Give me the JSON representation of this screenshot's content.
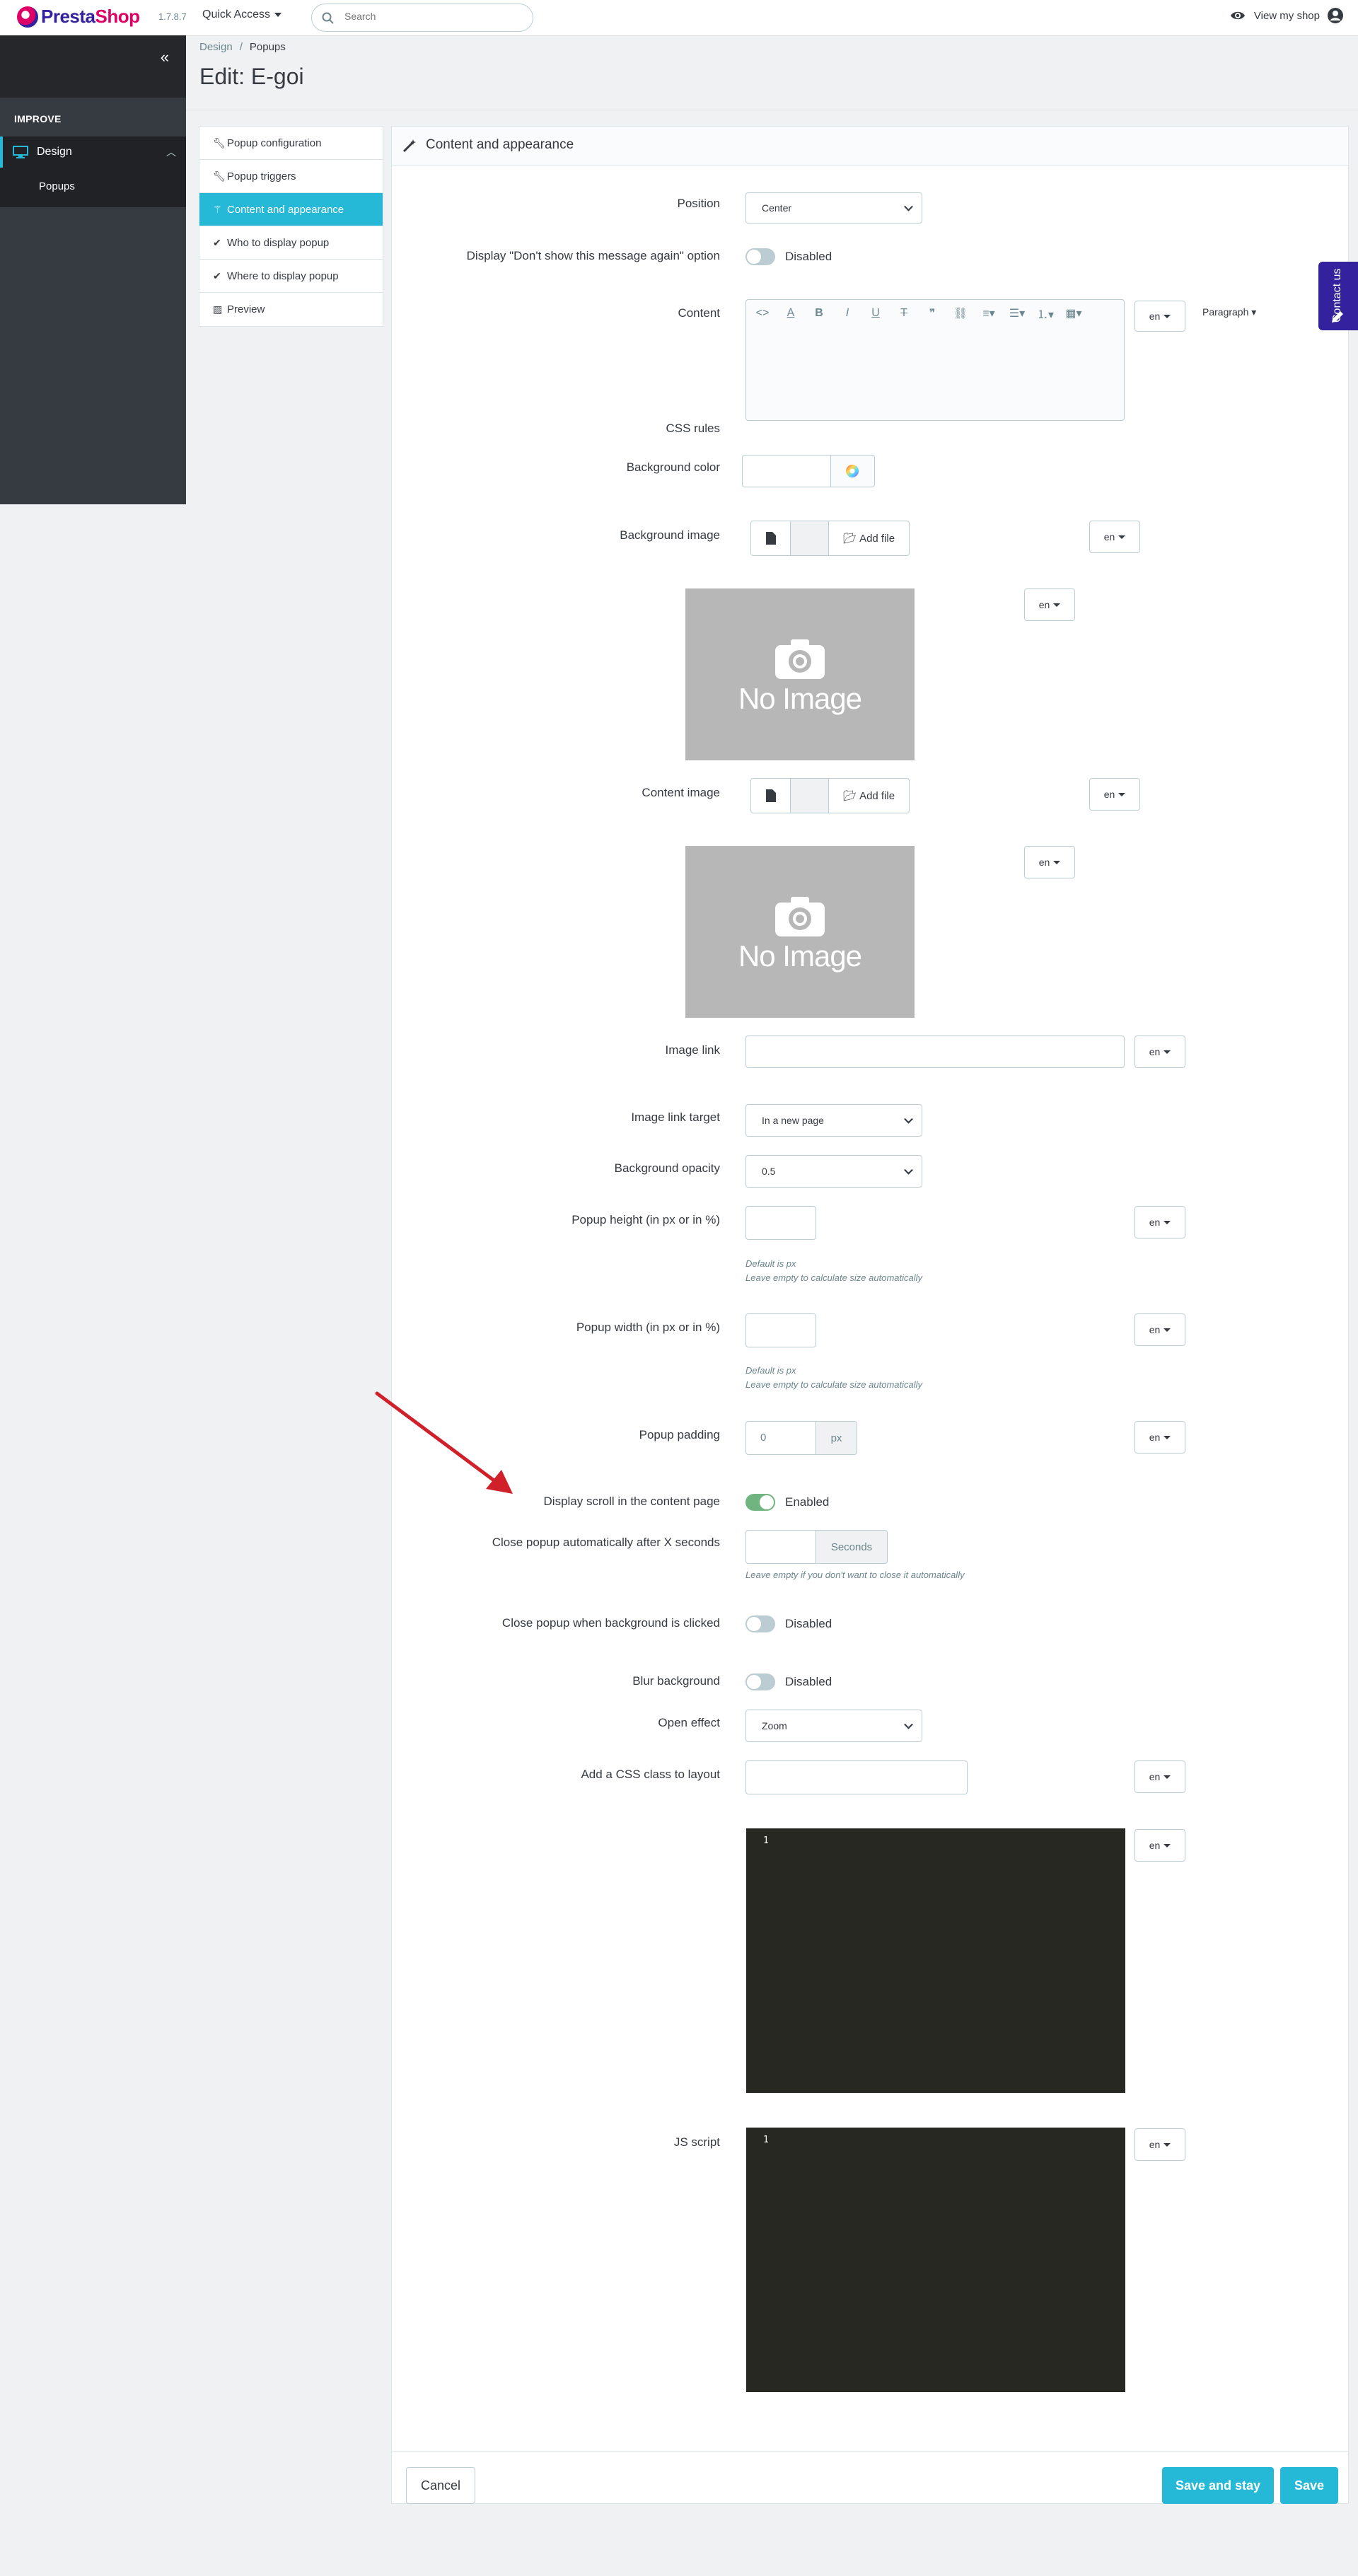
{
  "header": {
    "logo_text_a": "Presta",
    "logo_text_b": "Shop",
    "version": "1.7.8.7",
    "quick_access": "Quick Access",
    "search_placeholder": "Search",
    "view_shop": "View my shop"
  },
  "sidebar": {
    "section": "IMPROVE",
    "items": [
      {
        "label": "Design",
        "active": true
      },
      {
        "label": "Popups",
        "active": true
      }
    ]
  },
  "breadcrumb": {
    "parent": "Design",
    "current": "Popups"
  },
  "page_title": "Edit: E-goi",
  "tabs": [
    {
      "label": "Popup configuration",
      "icon": "wrench-icon"
    },
    {
      "label": "Popup triggers",
      "icon": "wrench-icon"
    },
    {
      "label": "Content and appearance",
      "icon": "magic-wand-icon",
      "active": true
    },
    {
      "label": "Who to display popup",
      "icon": "check-icon"
    },
    {
      "label": "Where to display popup",
      "icon": "check-icon"
    },
    {
      "label": "Preview",
      "icon": "image-icon"
    }
  ],
  "panel": {
    "title": "Content and appearance",
    "fields": {
      "position": {
        "label": "Position",
        "value": "Center"
      },
      "dont_show": {
        "label": "Display \"Don't show this message again\" option",
        "state": "Disabled"
      },
      "content": {
        "label": "Content",
        "paragraph": "Paragraph"
      },
      "bg_color": {
        "label": "Background color"
      },
      "bg_image": {
        "label": "Background image",
        "add_file": "Add file",
        "no_image": "No Image"
      },
      "content_image": {
        "label": "Content image",
        "add_file": "Add file",
        "no_image": "No Image"
      },
      "image_link": {
        "label": "Image link"
      },
      "image_link_target": {
        "label": "Image link target",
        "value": "In a new page"
      },
      "bg_opacity": {
        "label": "Background opacity",
        "value": "0.5"
      },
      "popup_height": {
        "label": "Popup height (in px or in %)",
        "help1": "Default is px",
        "help2": "Leave empty to calculate size automatically"
      },
      "popup_width": {
        "label": "Popup width (in px or in %)",
        "help1": "Default is px",
        "help2": "Leave empty to calculate size automatically"
      },
      "popup_padding": {
        "label": "Popup padding",
        "value": "0",
        "unit": "px"
      },
      "display_scroll": {
        "label": "Display scroll in the content page",
        "state": "Enabled"
      },
      "close_auto": {
        "label": "Close popup automatically after X seconds",
        "unit": "Seconds",
        "help": "Leave empty if you don't want to close it automatically"
      },
      "close_bg": {
        "label": "Close popup when background is clicked",
        "state": "Disabled"
      },
      "blur_bg": {
        "label": "Blur background",
        "state": "Disabled"
      },
      "open_effect": {
        "label": "Open effect",
        "value": "Zoom"
      },
      "css_class": {
        "label": "Add a CSS class to layout"
      },
      "css_rules": {
        "label": "CSS rules",
        "line": "1"
      },
      "js_script": {
        "label": "JS script",
        "line": "1"
      }
    },
    "lang": "en",
    "buttons": {
      "cancel": "Cancel",
      "save_stay": "Save and stay",
      "save": "Save"
    }
  },
  "contact": "Contact us",
  "colors": {
    "accent": "#25b9d7",
    "sidebar": "#363a41",
    "brand": "#34219e",
    "arrow": "#d0202a"
  }
}
